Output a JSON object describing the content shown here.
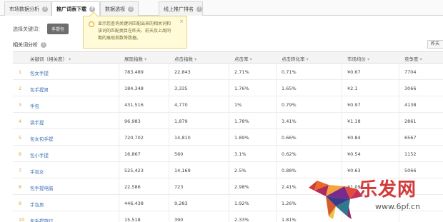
{
  "tabs": [
    {
      "label": "市场数据分析",
      "active": false
    },
    {
      "label": "推广词表下载",
      "active": true
    },
    {
      "label": "数据透视",
      "active": false
    },
    {
      "label": "线上推广排名",
      "active": false
    }
  ],
  "keyword_selector": {
    "label": "选择关键词：",
    "value": "手提包"
  },
  "section": {
    "title": "相关词分析"
  },
  "right_button": {
    "label": "昨天"
  },
  "tooltip": {
    "text_lines": [
      "显示您查询关键词匹配出来的相关词和",
      "该词的匹配类目在昨天、前天及上周同",
      "期的展现指数等数据。"
    ],
    "close": "×"
  },
  "table": {
    "headers": [
      "关键词（相关度）",
      "展现指数",
      "点击指数",
      "点击率",
      "点击转化率",
      "市场均价",
      "竞争度"
    ],
    "rows": [
      {
        "rank": "1",
        "keyword": "包女手提",
        "impressions": "783,489",
        "clicks": "22,843",
        "ctr": "2.71%",
        "cvr": "0.71%",
        "price": "¥0.67",
        "competition": "7704"
      },
      {
        "rank": "2",
        "keyword": "包手提男",
        "impressions": "184,348",
        "clicks": "3,335",
        "ctr": "1.76%",
        "cvr": "1.65%",
        "price": "¥2.1",
        "competition": "3066"
      },
      {
        "rank": "3",
        "keyword": "手包",
        "impressions": "431,516",
        "clicks": "4,770",
        "ctr": "1%",
        "cvr": "0.79%",
        "price": "¥0.97",
        "competition": "4138"
      },
      {
        "rank": "4",
        "keyword": "袋手提",
        "impressions": "96,983",
        "clicks": "1,879",
        "ctr": "1.78%",
        "cvr": "3.41%",
        "price": "¥1.18",
        "competition": "2861"
      },
      {
        "rank": "5",
        "keyword": "包女包手提",
        "impressions": "720,702",
        "clicks": "14,810",
        "ctr": "1.89%",
        "cvr": "0.66%",
        "price": "¥0.84",
        "competition": "6567"
      },
      {
        "rank": "6",
        "keyword": "包小手提",
        "impressions": "16,867",
        "clicks": "560",
        "ctr": "3.1%",
        "cvr": "0.62%",
        "price": "¥0.54",
        "competition": "1152"
      },
      {
        "rank": "7",
        "keyword": "手包女",
        "impressions": "525,423",
        "clicks": "14,169",
        "ctr": "2.5%",
        "cvr": "0.88%",
        "price": "¥0.63",
        "competition": "5066"
      },
      {
        "rank": "8",
        "keyword": "包手提电脑",
        "impressions": "22,586",
        "clicks": "723",
        "ctr": "2.98%",
        "cvr": "2.41%",
        "price": "¥1.09",
        "competition": ""
      },
      {
        "rank": "9",
        "keyword": "手包男",
        "impressions": "446,438",
        "clicks": "9,283",
        "ctr": "1.92%",
        "cvr": "1.26%",
        "price": "",
        "competition": ""
      },
      {
        "rank": "10",
        "keyword": "包手提旅行",
        "impressions": "15,518",
        "clicks": "390",
        "ctr": "2.33%",
        "cvr": "1.81%",
        "price": "",
        "competition": ""
      }
    ]
  },
  "watermark": {
    "brand": "乐发网",
    "url": "www.6pf.cn"
  },
  "colors": {
    "link": "#3a6fb5",
    "rank": "#e0a030",
    "brand": "#d23a3a"
  }
}
